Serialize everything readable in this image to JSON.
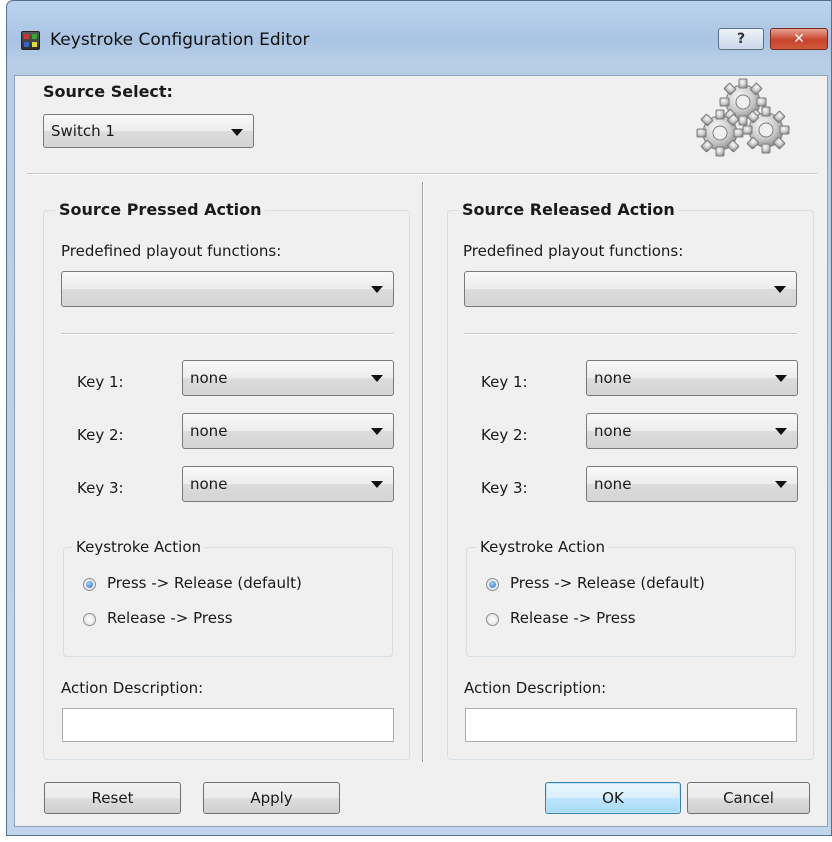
{
  "window": {
    "title": "Keystroke Configuration Editor",
    "help_label": "?",
    "close_label": "✕"
  },
  "source_select": {
    "label": "Source Select:",
    "value": "Switch 1"
  },
  "pressed": {
    "title": "Source Pressed Action",
    "predefined_label": "Predefined playout functions:",
    "predefined_value": "",
    "keys": [
      {
        "label": "Key 1:",
        "value": "none"
      },
      {
        "label": "Key 2:",
        "value": "none"
      },
      {
        "label": "Key 3:",
        "value": "none"
      }
    ],
    "keystroke_action": {
      "title": "Keystroke Action",
      "options": [
        {
          "label": "Press -> Release (default)",
          "checked": true
        },
        {
          "label": "Release -> Press",
          "checked": false
        }
      ]
    },
    "description_label": "Action Description:",
    "description_value": ""
  },
  "released": {
    "title": "Source Released Action",
    "predefined_label": "Predefined playout functions:",
    "predefined_value": "",
    "keys": [
      {
        "label": "Key 1:",
        "value": "none"
      },
      {
        "label": "Key 2:",
        "value": "none"
      },
      {
        "label": "Key 3:",
        "value": "none"
      }
    ],
    "keystroke_action": {
      "title": "Keystroke Action",
      "options": [
        {
          "label": "Press -> Release (default)",
          "checked": true
        },
        {
          "label": "Release -> Press",
          "checked": false
        }
      ]
    },
    "description_label": "Action Description:",
    "description_value": ""
  },
  "buttons": {
    "reset": "Reset",
    "apply": "Apply",
    "ok": "OK",
    "cancel": "Cancel"
  },
  "icons": {
    "app": "keystroke-app-icon",
    "gears": "gears-icon",
    "dropdown": "chevron-down-icon"
  }
}
